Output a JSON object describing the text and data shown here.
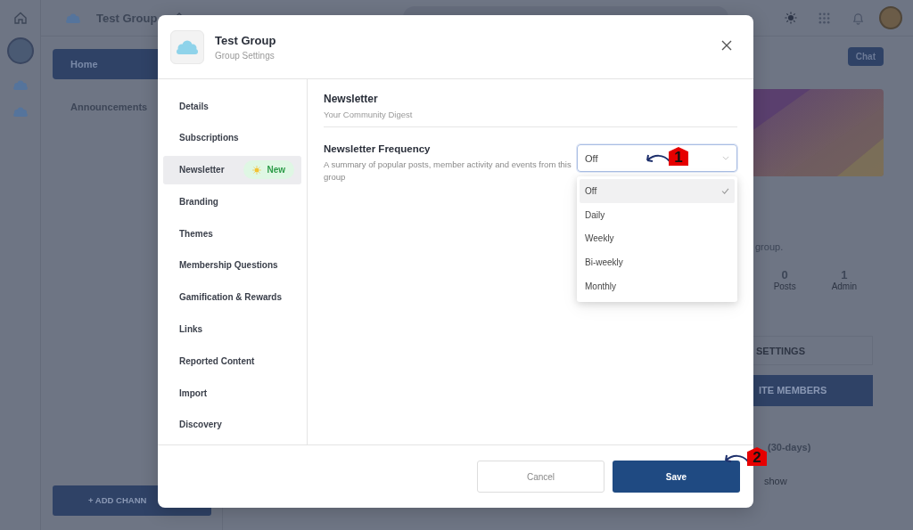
{
  "app": {
    "group_name": "Test Group",
    "nav": [
      {
        "label": "Home",
        "selected": true
      },
      {
        "label": "Announcements",
        "selected": false
      }
    ],
    "add_channel": "+ ADD CHANN",
    "chat": "Chat",
    "about_tail": "group.",
    "stats": [
      {
        "value": "0",
        "label": "Posts"
      },
      {
        "value": "1",
        "label": "Admin"
      }
    ],
    "settings_button": "SETTINGS",
    "invite_button": "ITE MEMBERS",
    "section_tail": "(30-days)",
    "link_tail": "show"
  },
  "dialog": {
    "title": "Test Group",
    "subtitle": "Group Settings",
    "nav": [
      {
        "label": "Details",
        "selected": false
      },
      {
        "label": "Subscriptions",
        "selected": false
      },
      {
        "label": "Newsletter",
        "selected": true,
        "badge": "New"
      },
      {
        "label": "Branding",
        "selected": false
      },
      {
        "label": "Themes",
        "selected": false
      },
      {
        "label": "Membership Questions",
        "selected": false
      },
      {
        "label": "Gamification & Rewards",
        "selected": false
      },
      {
        "label": "Links",
        "selected": false
      },
      {
        "label": "Reported Content",
        "selected": false
      },
      {
        "label": "Import",
        "selected": false
      },
      {
        "label": "Discovery",
        "selected": false
      }
    ],
    "section": {
      "title": "Newsletter",
      "subtitle": "Your Community Digest"
    },
    "field": {
      "label": "Newsletter Frequency",
      "description": "A summary of popular posts, member activity and events from this group",
      "value": "Off",
      "expanded": true,
      "options": [
        {
          "label": "Off",
          "selected": true
        },
        {
          "label": "Daily",
          "selected": false
        },
        {
          "label": "Weekly",
          "selected": false
        },
        {
          "label": "Bi-weekly",
          "selected": false
        },
        {
          "label": "Monthly",
          "selected": false
        }
      ]
    },
    "buttons": {
      "cancel": "Cancel",
      "save": "Save"
    }
  },
  "callouts": [
    {
      "label": "1"
    },
    {
      "label": "2"
    }
  ]
}
